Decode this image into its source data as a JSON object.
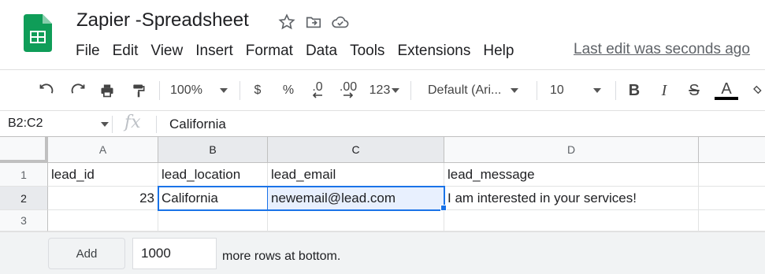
{
  "header": {
    "doc_title": "Zapier -Spreadsheet",
    "last_edit": "Last edit was seconds ago",
    "menu": [
      "File",
      "Edit",
      "View",
      "Insert",
      "Format",
      "Data",
      "Tools",
      "Extensions",
      "Help"
    ]
  },
  "toolbar": {
    "zoom": "100%",
    "currency": "$",
    "percent": "%",
    "decrease_decimal": ".0",
    "increase_decimal": ".00",
    "more_formats": "123",
    "font": "Default (Ari...",
    "font_size": "10",
    "bold": "B",
    "italic": "I",
    "strikethrough": "S",
    "text_color": "A"
  },
  "formula_bar": {
    "name_box": "B2:C2",
    "fx": "fx",
    "value": "California"
  },
  "grid": {
    "columns": [
      "A",
      "B",
      "C",
      "D"
    ],
    "rows": [
      "1",
      "2",
      "3"
    ],
    "cells": {
      "A1": "lead_id",
      "B1": "lead_location",
      "C1": "lead_email",
      "D1": "lead_message",
      "A2": "23",
      "B2": "California",
      "C2": "newemail@lead.com",
      "D2": "I am interested in your services!"
    }
  },
  "bottom": {
    "add_label": "Add",
    "rows_value": "1000",
    "rows_label": "more rows at bottom."
  },
  "colors": {
    "accent": "#1a73e8",
    "sheets_green": "#0f9d58",
    "selection_fill": "#e8f0fe"
  }
}
